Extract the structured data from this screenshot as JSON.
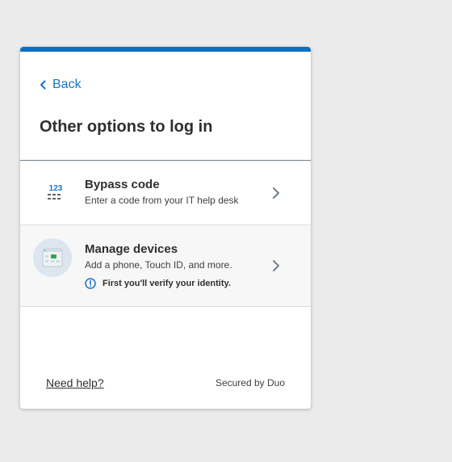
{
  "colors": {
    "accent": "#0a6fc2",
    "link": "#1a73c8",
    "page_background": "#ebebeb"
  },
  "header": {
    "back_label": "Back",
    "title": "Other options to log in"
  },
  "options": [
    {
      "title": "Bypass code",
      "description": "Enter a code from your IT help desk",
      "icon": "bypass-code-icon",
      "icon_text": "123"
    },
    {
      "title": "Manage devices",
      "description": "Add a phone, Touch ID, and more.",
      "icon": "device-management-icon",
      "notice": "First you'll verify your identity."
    }
  ],
  "footer": {
    "help_label": "Need help?",
    "secured_label": "Secured by Duo"
  }
}
